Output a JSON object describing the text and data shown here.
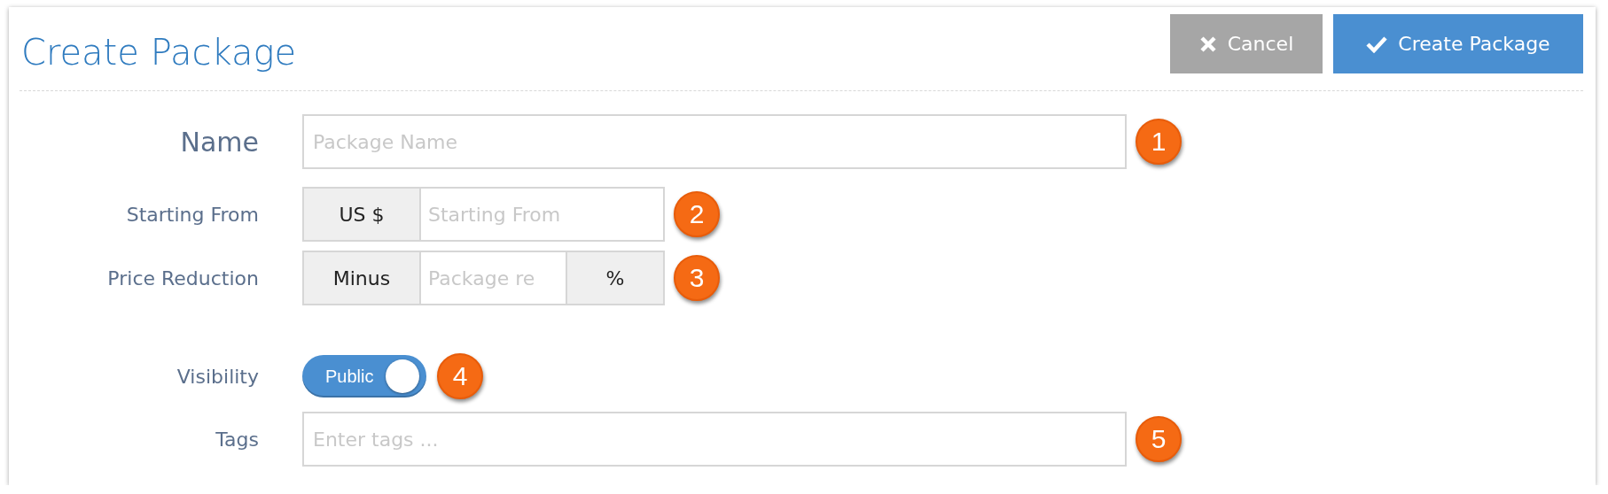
{
  "header": {
    "title": "Create Package",
    "buttons": [
      {
        "kind": "cancel",
        "label": "Cancel"
      },
      {
        "kind": "confirm",
        "label": "Create Package"
      }
    ]
  },
  "fields": [
    {
      "kind": "text",
      "label": "Name",
      "primary": true,
      "placeholder": "Package Name",
      "badge": "1"
    },
    {
      "kind": "prefixed",
      "label": "Starting From",
      "prefix": "US $",
      "placeholder": "Starting From",
      "badge": "2"
    },
    {
      "kind": "affixed",
      "label": "Price Reduction",
      "prefix": "Minus",
      "placeholder": "Package re",
      "suffix": "%",
      "badge": "3"
    },
    {
      "kind": "toggle",
      "label": "Visibility",
      "text": "Public",
      "on": true,
      "badge": "4"
    },
    {
      "kind": "text",
      "label": "Tags",
      "placeholder": "Enter tags ...",
      "badge": "5"
    }
  ]
}
